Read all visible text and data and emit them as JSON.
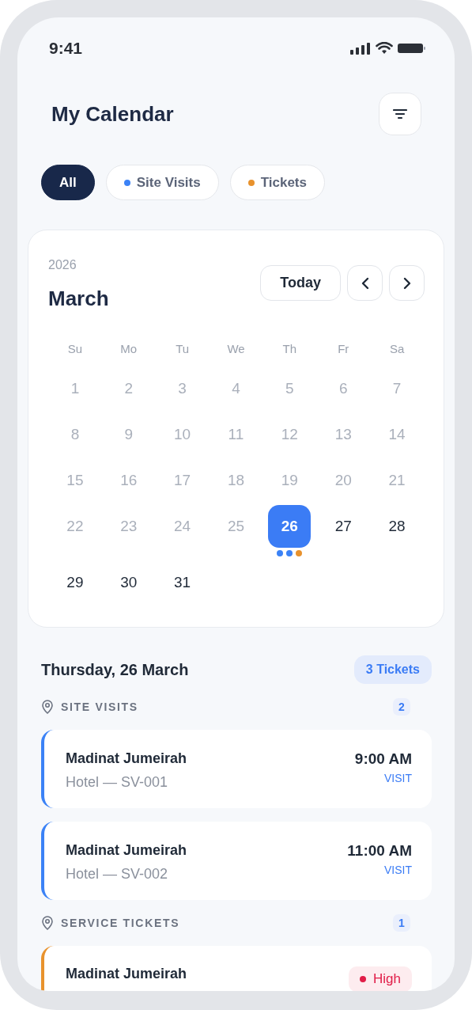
{
  "status_bar": {
    "time": "9:41"
  },
  "header": {
    "title": "My Calendar"
  },
  "filters": [
    {
      "label": "All",
      "selected": true
    },
    {
      "label": "Site Visits",
      "selected": false,
      "color": "#3b82f6"
    },
    {
      "label": "Tickets",
      "selected": false,
      "color": "#e8922d"
    }
  ],
  "calendar": {
    "year": "2026",
    "month": "March",
    "today_button": "Today",
    "weekdays": [
      "Su",
      "Mo",
      "Tu",
      "We",
      "Th",
      "Fr",
      "Sa"
    ],
    "days": [
      {
        "label": "1",
        "muted": true,
        "selected": false
      },
      {
        "label": "2",
        "muted": true,
        "selected": false
      },
      {
        "label": "3",
        "muted": true,
        "selected": false
      },
      {
        "label": "4",
        "muted": true,
        "selected": false
      },
      {
        "label": "5",
        "muted": true,
        "selected": false
      },
      {
        "label": "6",
        "muted": true,
        "selected": false
      },
      {
        "label": "7",
        "muted": true,
        "selected": false
      },
      {
        "label": "8",
        "muted": true,
        "selected": false
      },
      {
        "label": "9",
        "muted": true,
        "selected": false
      },
      {
        "label": "10",
        "muted": true,
        "selected": false
      },
      {
        "label": "11",
        "muted": true,
        "selected": false
      },
      {
        "label": "12",
        "muted": true,
        "selected": false
      },
      {
        "label": "13",
        "muted": true,
        "selected": false
      },
      {
        "label": "14",
        "muted": true,
        "selected": false
      },
      {
        "label": "15",
        "muted": true,
        "selected": false
      },
      {
        "label": "16",
        "muted": true,
        "selected": false
      },
      {
        "label": "17",
        "muted": true,
        "selected": false
      },
      {
        "label": "18",
        "muted": true,
        "selected": false
      },
      {
        "label": "19",
        "muted": true,
        "selected": false
      },
      {
        "label": "20",
        "muted": true,
        "selected": false
      },
      {
        "label": "21",
        "muted": true,
        "selected": false
      },
      {
        "label": "22",
        "muted": true,
        "selected": false
      },
      {
        "label": "23",
        "muted": true,
        "selected": false
      },
      {
        "label": "24",
        "muted": true,
        "selected": false
      },
      {
        "label": "25",
        "muted": true,
        "selected": false
      },
      {
        "label": "26",
        "muted": false,
        "selected": true,
        "events": [
          {
            "color": "#3b82f6"
          },
          {
            "color": "#3b82f6"
          },
          {
            "color": "#e8922d"
          }
        ]
      },
      {
        "label": "27",
        "muted": false,
        "selected": false
      },
      {
        "label": "28",
        "muted": false,
        "selected": false
      },
      {
        "label": "29",
        "muted": false,
        "selected": false
      },
      {
        "label": "30",
        "muted": false,
        "selected": false
      },
      {
        "label": "31",
        "muted": false,
        "selected": false
      }
    ]
  },
  "agenda": {
    "date": "Thursday, 26 March",
    "count_badge": "3 Tickets",
    "sections": [
      {
        "title": "SITE VISITS",
        "count": "2",
        "items": [
          {
            "kind": "visit",
            "color": "#3b82f6",
            "title": "Madinat Jumeirah",
            "subtitle": "Hotel — SV-001",
            "time": "9:00 AM",
            "tag": "VISIT"
          },
          {
            "kind": "visit",
            "color": "#3b82f6",
            "title": "Madinat Jumeirah",
            "subtitle": "Hotel — SV-002",
            "time": "11:00 AM",
            "tag": "VISIT"
          }
        ]
      },
      {
        "title": "SERVICE TICKETS",
        "count": "1",
        "items": [
          {
            "kind": "ticket",
            "color": "#e8922d",
            "title": "Madinat Jumeirah",
            "priority": {
              "label": "High",
              "color": "#e11d48"
            }
          }
        ]
      }
    ]
  }
}
